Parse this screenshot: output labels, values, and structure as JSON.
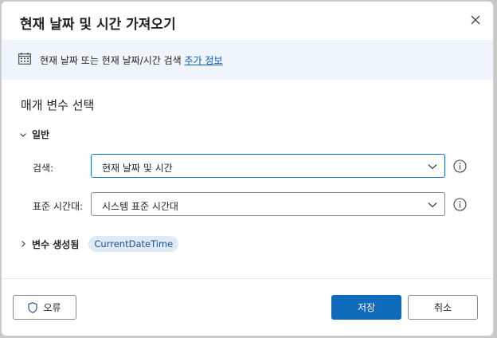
{
  "dialog": {
    "title": "현재 날짜 및 시간 가져오기"
  },
  "info": {
    "description": "현재 날짜 또는 현재 날짜/시간 검색",
    "link": "추가 정보"
  },
  "params": {
    "section_title": "매개 변수 선택",
    "group_label": "일반",
    "retrieve_label": "검색:",
    "retrieve_value": "현재 날짜 및 시간",
    "timezone_label": "표준 시간대:",
    "timezone_value": "시스템 표준 시간대"
  },
  "variables": {
    "label": "변수 생성됨",
    "chip": "CurrentDateTime"
  },
  "footer": {
    "error_label": "오류",
    "save_label": "저장",
    "cancel_label": "취소"
  },
  "colors": {
    "accent": "#0f6cbd",
    "info_bg": "#eff5fc",
    "chip_bg": "#dfeaf7",
    "link": "#0f5bbd"
  }
}
